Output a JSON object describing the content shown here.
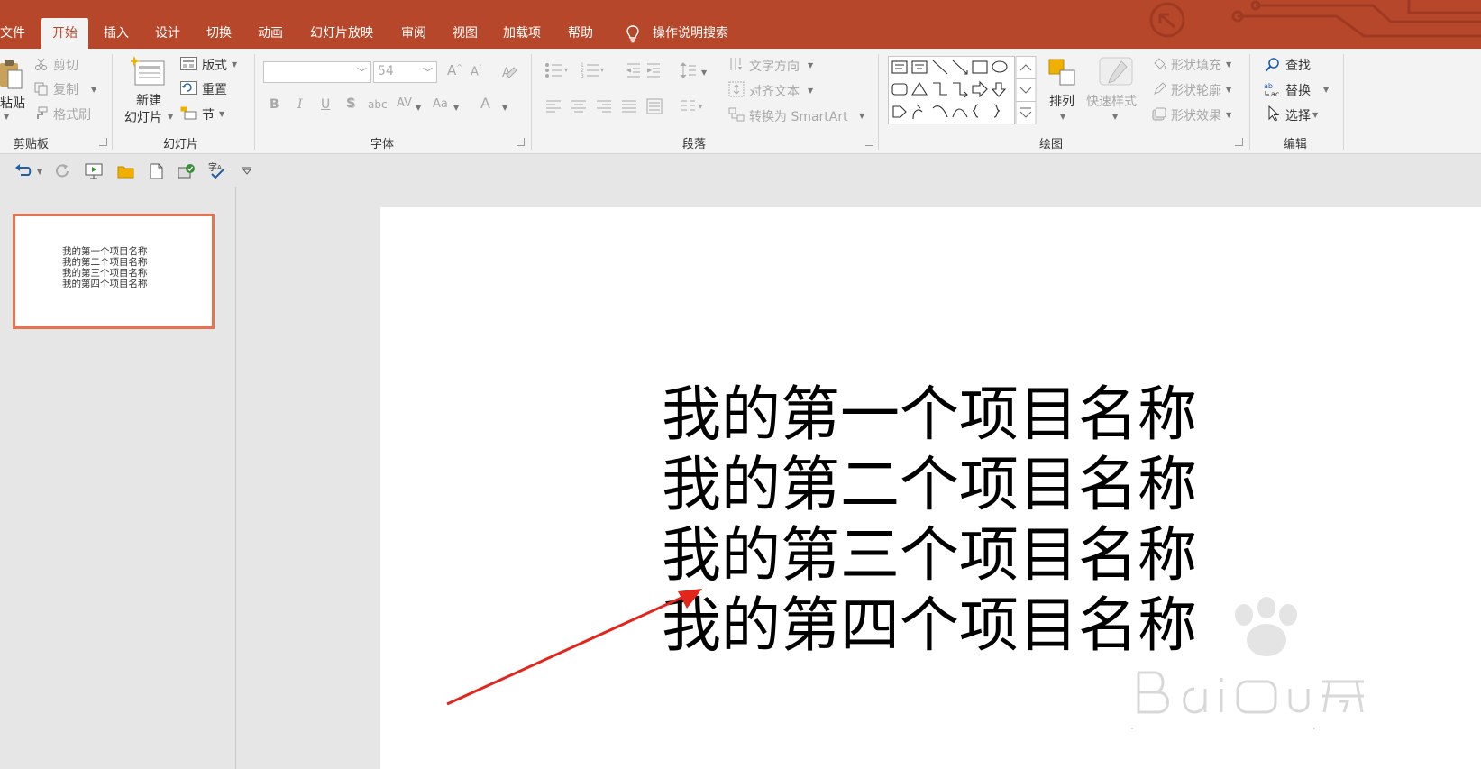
{
  "tabs": {
    "file": "文件",
    "home": "开始",
    "insert": "插入",
    "design": "设计",
    "transitions": "切换",
    "animations": "动画",
    "slideshow": "幻灯片放映",
    "review": "审阅",
    "view": "视图",
    "addins": "加载项",
    "help": "帮助",
    "tell_me": "操作说明搜索"
  },
  "clipboard": {
    "label": "剪贴板",
    "paste": "粘贴",
    "cut": "剪切",
    "copy": "复制",
    "format_painter": "格式刷"
  },
  "slides": {
    "label": "幻灯片",
    "new_slide_1": "新建",
    "new_slide_2": "幻灯片",
    "layout": "版式",
    "reset": "重置",
    "section": "节"
  },
  "font": {
    "label": "字体",
    "size": "54"
  },
  "paragraph": {
    "label": "段落",
    "text_direction": "文字方向",
    "align_text": "对齐文本",
    "convert_smartart": "转换为 SmartArt"
  },
  "drawing": {
    "label": "绘图",
    "arrange": "排列",
    "quick_styles": "快速样式",
    "shape_fill": "形状填充",
    "shape_outline": "形状轮廓",
    "shape_effects": "形状效果"
  },
  "editing": {
    "label": "编辑",
    "find": "查找",
    "replace": "替换",
    "select": "选择"
  },
  "slide_lines": [
    "我的第一个项目名称",
    "我的第二个项目名称",
    "我的第三个项目名称",
    "我的第四个项目名称"
  ],
  "colors": {
    "accent": "#b7472a",
    "thumb_border": "#e8714f",
    "arrow": "#e3261c"
  }
}
